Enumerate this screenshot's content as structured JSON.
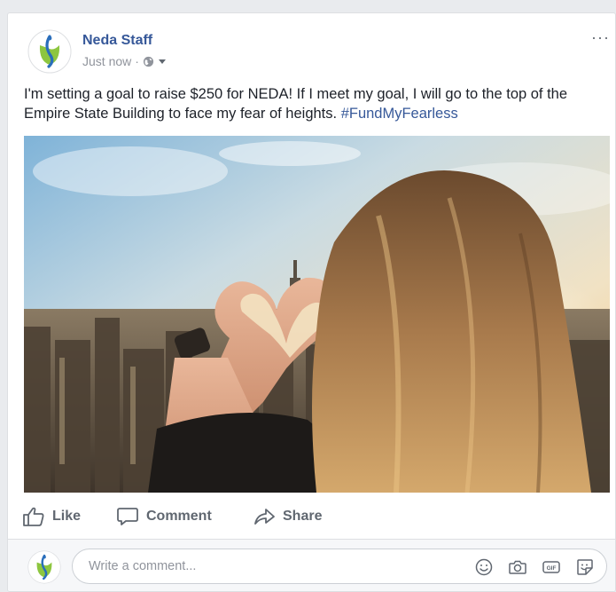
{
  "post": {
    "author": "Neda Staff",
    "timestamp": "Just now",
    "separator": "·",
    "privacy_icon": "globe-icon",
    "menu_icon": "more-options-icon",
    "more_label": "···",
    "text_main": "I'm setting a goal to raise $250 for NEDA! If I meet my goal, I will go to the top of the Empire State Building to face my fear of heights. ",
    "hashtag": "#FundMyFearless",
    "hashtag_color": "#365899",
    "author_color": "#365899"
  },
  "actions": {
    "like_label": "Like",
    "comment_label": "Comment",
    "share_label": "Share",
    "like_icon": "thumbs-up-icon",
    "comment_icon": "speech-bubble-icon",
    "share_icon": "share-arrow-icon"
  },
  "comment_box": {
    "placeholder": "Write a comment...",
    "icons": [
      "emoji-icon",
      "camera-icon",
      "gif-icon",
      "sticker-icon"
    ],
    "gif_label": "GIF"
  },
  "colors": {
    "background": "#e9ebee",
    "logo_green": "#8dc63f",
    "logo_blue": "#2a6ebb"
  }
}
